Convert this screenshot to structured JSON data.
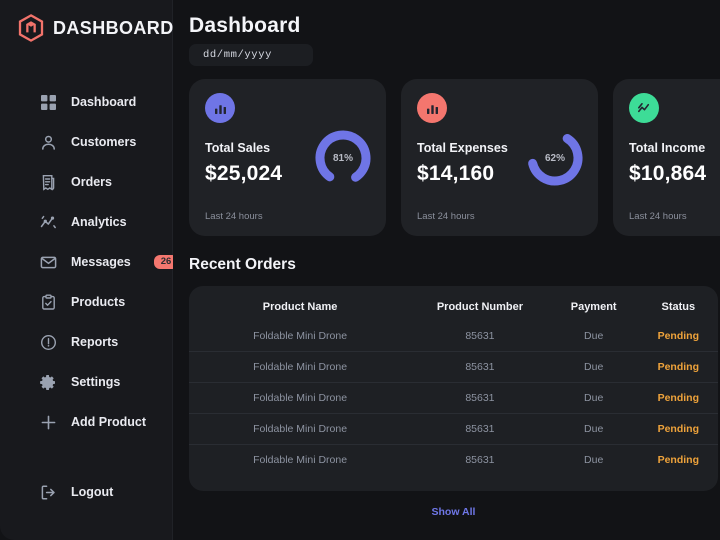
{
  "brand": {
    "title": "DASHBOARD",
    "logo_icon": "magento-hexagon-logo",
    "logo_color": "#f2736b"
  },
  "sidebar": {
    "items": [
      {
        "label": "Dashboard",
        "icon": "grid-icon"
      },
      {
        "label": "Customers",
        "icon": "user-icon"
      },
      {
        "label": "Orders",
        "icon": "receipt-icon"
      },
      {
        "label": "Analytics",
        "icon": "line-chart-icon"
      },
      {
        "label": "Messages",
        "icon": "envelope-icon",
        "badge": "26"
      },
      {
        "label": "Products",
        "icon": "clipboard-check-icon"
      },
      {
        "label": "Reports",
        "icon": "alert-circle-icon"
      },
      {
        "label": "Settings",
        "icon": "gear-icon"
      },
      {
        "label": "Add Product",
        "icon": "plus-icon"
      }
    ],
    "logout": {
      "label": "Logout",
      "icon": "logout-icon"
    }
  },
  "header": {
    "title": "Dashboard",
    "date_placeholder": "dd/mm/yyyy",
    "date_value": ""
  },
  "cards": [
    {
      "name": "Total Sales",
      "value": "$25,024",
      "sub": "Last 24 hours",
      "percent": "81%",
      "percent_num": 81,
      "icon": "bar-chart-icon",
      "icon_bg": "#6f75e6",
      "ring_color": "#6f75e6"
    },
    {
      "name": "Total Expenses",
      "value": "$14,160",
      "sub": "Last 24 hours",
      "percent": "62%",
      "percent_num": 62,
      "icon": "bar-chart-icon",
      "icon_bg": "#f4766e",
      "ring_color": "#6f75e6"
    },
    {
      "name": "Total Income",
      "value": "$10,864",
      "sub": "Last 24 hours",
      "percent": "",
      "percent_num": 0,
      "icon": "line-chart-icon",
      "icon_bg": "#3ddc97",
      "ring_color": "#6f75e6"
    }
  ],
  "recent_orders": {
    "title": "Recent Orders",
    "columns": [
      "Product Name",
      "Product Number",
      "Payment",
      "Status"
    ],
    "rows": [
      {
        "name": "Foldable Mini Drone",
        "number": "85631",
        "payment": "Due",
        "status": "Pending"
      },
      {
        "name": "Foldable Mini Drone",
        "number": "85631",
        "payment": "Due",
        "status": "Pending"
      },
      {
        "name": "Foldable Mini Drone",
        "number": "85631",
        "payment": "Due",
        "status": "Pending"
      },
      {
        "name": "Foldable Mini Drone",
        "number": "85631",
        "payment": "Due",
        "status": "Pending"
      },
      {
        "name": "Foldable Mini Drone",
        "number": "85631",
        "payment": "Due",
        "status": "Pending"
      }
    ],
    "show_all": "Show All",
    "status_color": "#efa33b",
    "link_color": "#6f77e8"
  }
}
